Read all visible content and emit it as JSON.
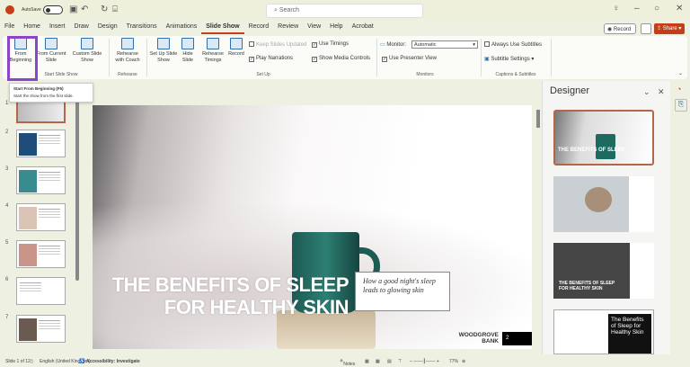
{
  "titlebar": {
    "autosave_label": "AutoSave",
    "search_placeholder": "Search"
  },
  "tabs": [
    "File",
    "Home",
    "Insert",
    "Draw",
    "Design",
    "Transitions",
    "Animations",
    "Slide Show",
    "Record",
    "Review",
    "View",
    "Help",
    "Acrobat"
  ],
  "active_tab": "Slide Show",
  "header_buttons": {
    "record": "Record",
    "share": "Share"
  },
  "ribbon": {
    "start": {
      "from_beginning": "From Beginning",
      "from_current": "From Current Slide",
      "custom": "Custom Slide Show",
      "group": "Start Slide Show"
    },
    "rehearse": {
      "coach": "Rehearse with Coach",
      "group": "Rehearse"
    },
    "setup": {
      "setup_show": "Set Up Slide Show",
      "hide": "Hide Slide",
      "timings": "Rehearse Timings",
      "record": "Record",
      "keep_updated": "Keep Slides Updated",
      "play_narrations": "Play Narrations",
      "use_timings": "Use Timings",
      "show_media": "Show Media Controls",
      "group": "Set Up"
    },
    "monitors": {
      "monitor_label": "Monitor:",
      "monitor_value": "Automatic",
      "presenter_view": "Use Presenter View",
      "group": "Monitors"
    },
    "captions": {
      "always_subtitles": "Always Use Subtitles",
      "subtitle_settings": "Subtitle Settings",
      "group": "Captions & Subtitles"
    }
  },
  "tooltip": {
    "title": "Start From Beginning (F5)",
    "body": "Start the show from the first slide."
  },
  "slides_panel": {
    "numbers": [
      "1",
      "2",
      "3",
      "4",
      "5",
      "6",
      "7"
    ]
  },
  "slide": {
    "headline_1": "THE BENEFITS OF SLEEP",
    "headline_2": "FOR HEALTHY SKIN",
    "quote": "How a good night's sleep leads to glowing skin",
    "brand_1": "WOODGROVE",
    "brand_2": "BANK",
    "page": "2"
  },
  "designer": {
    "title": "Designer",
    "option4_title": "The Benefits of Sleep for Healthy Skin"
  },
  "status": {
    "slide": "Slide 1 of 12",
    "language": "English (United Kingdom)",
    "accessibility": "Accessibility: Investigate",
    "notes": "Notes",
    "zoom": "77%"
  }
}
